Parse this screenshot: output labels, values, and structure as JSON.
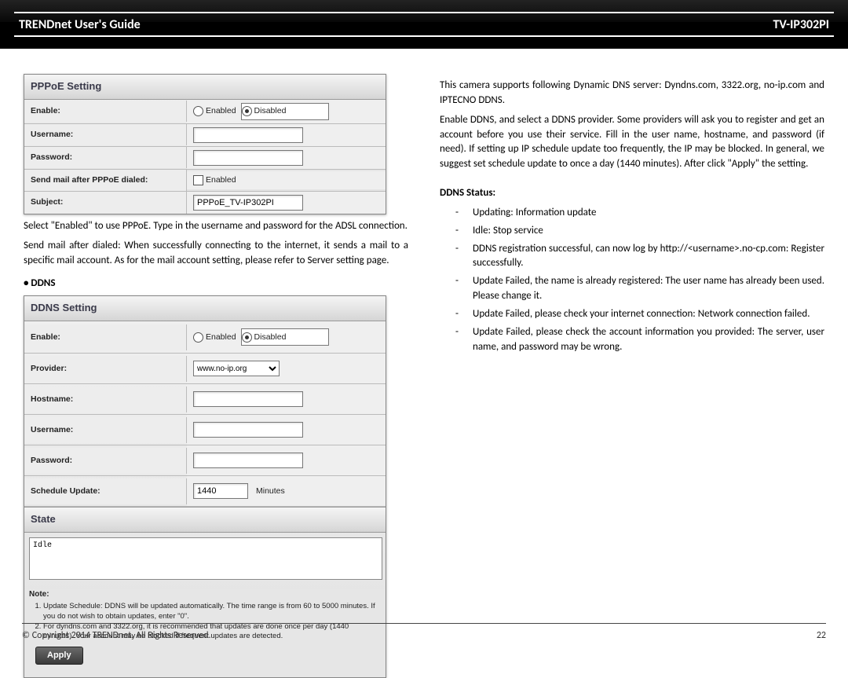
{
  "header": {
    "left": "TRENDnet User's Guide",
    "right": "TV-IP302PI"
  },
  "pppoe_panel": {
    "title": "PPPoE Setting",
    "rows": {
      "enable_lbl": "Enable:",
      "enabled_opt": "Enabled",
      "disabled_opt": "Disabled",
      "username_lbl": "Username:",
      "password_lbl": "Password:",
      "sendmail_lbl": "Send mail after PPPoE dialed:",
      "subject_lbl": "Subject:",
      "subject_val": "PPPoE_TV-IP302PI"
    }
  },
  "left_text": {
    "p1": "Select \"Enabled\" to use PPPoE. Type in the username and password for the ADSL connection.",
    "p2": "Send mail after dialed: When successfully connecting to the internet, it sends a mail to a specific mail account. As for the mail account setting, please refer to Server setting page.",
    "ddns_hdr": "DDNS"
  },
  "ddns_panel": {
    "title": "DDNS Setting",
    "rows": {
      "enable_lbl": "Enable:",
      "enabled_opt": "Enabled",
      "disabled_opt": "Disabled",
      "provider_lbl": "Provider:",
      "provider_val": "www.no-ip.org",
      "hostname_lbl": "Hostname:",
      "username_lbl": "Username:",
      "password_lbl": "Password:",
      "schedule_lbl": "Schedule Update:",
      "schedule_val": "1440",
      "schedule_units": "Minutes"
    },
    "state_hdr": "State",
    "state_val": "Idle",
    "notes": {
      "hdr": "Note:",
      "n1": "Update Schedule: DDNS will be updated automatically. The time range is from 60 to 5000 minutes. If you do not wish to obtain updates, enter \"0\".",
      "n2": "For dyndns.com and 3322.org, it is recommended that updates are done once per day (1440 minutes). Your account may be blocked if frequent updates are detected."
    },
    "apply": "Apply"
  },
  "right_text": {
    "p1": "This camera supports following Dynamic DNS server: Dyndns.com, 3322.org, no-ip.com and IPTECNO DDNS.",
    "p2": "Enable DDNS, and select a DDNS provider. Some providers will ask you to register and get an account before you use their service.  Fill in the user name, hostname, and password (if need). If setting up IP schedule update too frequently, the IP may be blocked. In general, we suggest set schedule update to once a day (1440 minutes). After click \"Apply\" the setting.",
    "status_hdr": "DDNS Status:",
    "items": {
      "i1": "Updating: Information update",
      "i2": "Idle: Stop service",
      "i3": "DDNS registration successful, can now log by http://<username>.no-cp.com: Register successfully.",
      "i4": "Update Failed, the name is already registered: The user name has already been used. Please change it.",
      "i5": "Update Failed, please check your internet connection: Network connection failed.",
      "i6": "Update Failed, please check the account information you provided: The server, user name, and password may be wrong."
    }
  },
  "footer": {
    "copyright": "© Copyright 2014 TRENDnet.  All Rights Reserved.",
    "page": "22"
  }
}
